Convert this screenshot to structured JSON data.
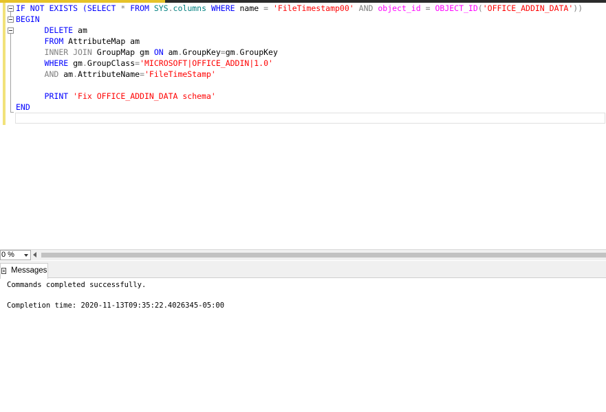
{
  "editor": {
    "lines": [
      [
        {
          "t": "IF NOT EXISTS (",
          "c": "kw"
        },
        {
          "t": "SELECT",
          "c": "kw"
        },
        {
          "t": " * ",
          "c": "gray"
        },
        {
          "t": "FROM",
          "c": "kw"
        },
        {
          "t": " ",
          "c": "plain"
        },
        {
          "t": "SYS",
          "c": "sys"
        },
        {
          "t": ".",
          "c": "gray"
        },
        {
          "t": "columns",
          "c": "sys"
        },
        {
          "t": " ",
          "c": "plain"
        },
        {
          "t": "WHERE",
          "c": "kw"
        },
        {
          "t": " name ",
          "c": "plain"
        },
        {
          "t": "=",
          "c": "gray"
        },
        {
          "t": " ",
          "c": "plain"
        },
        {
          "t": "'FileTimestamp00'",
          "c": "str"
        },
        {
          "t": " ",
          "c": "plain"
        },
        {
          "t": "AND",
          "c": "gray"
        },
        {
          "t": " object_id ",
          "c": "fn"
        },
        {
          "t": "=",
          "c": "gray"
        },
        {
          "t": " ",
          "c": "plain"
        },
        {
          "t": "OBJECT_ID",
          "c": "fn"
        },
        {
          "t": "(",
          "c": "gray"
        },
        {
          "t": "'OFFICE_ADDIN_DATA'",
          "c": "str"
        },
        {
          "t": "))",
          "c": "gray"
        }
      ],
      [
        {
          "t": "BEGIN",
          "c": "kw"
        }
      ],
      [
        {
          "t": "      ",
          "c": "plain"
        },
        {
          "t": "DELETE",
          "c": "kw"
        },
        {
          "t": " am",
          "c": "plain"
        }
      ],
      [
        {
          "t": "      ",
          "c": "plain"
        },
        {
          "t": "FROM",
          "c": "kw"
        },
        {
          "t": " AttributeMap am",
          "c": "plain"
        }
      ],
      [
        {
          "t": "      ",
          "c": "plain"
        },
        {
          "t": "INNER JOIN",
          "c": "gray"
        },
        {
          "t": " GroupMap gm ",
          "c": "plain"
        },
        {
          "t": "ON",
          "c": "kw"
        },
        {
          "t": " am",
          "c": "plain"
        },
        {
          "t": ".",
          "c": "gray"
        },
        {
          "t": "GroupKey",
          "c": "plain"
        },
        {
          "t": "=",
          "c": "gray"
        },
        {
          "t": "gm",
          "c": "plain"
        },
        {
          "t": ".",
          "c": "gray"
        },
        {
          "t": "GroupKey",
          "c": "plain"
        }
      ],
      [
        {
          "t": "      ",
          "c": "plain"
        },
        {
          "t": "WHERE",
          "c": "kw"
        },
        {
          "t": " gm",
          "c": "plain"
        },
        {
          "t": ".",
          "c": "gray"
        },
        {
          "t": "GroupClass",
          "c": "plain"
        },
        {
          "t": "=",
          "c": "gray"
        },
        {
          "t": "'MICROSOFT|OFFICE_ADDIN|1.0'",
          "c": "str"
        }
      ],
      [
        {
          "t": "      ",
          "c": "plain"
        },
        {
          "t": "AND",
          "c": "gray"
        },
        {
          "t": " am",
          "c": "plain"
        },
        {
          "t": ".",
          "c": "gray"
        },
        {
          "t": "AttributeName",
          "c": "plain"
        },
        {
          "t": "=",
          "c": "gray"
        },
        {
          "t": "'FileTimeStamp'",
          "c": "str"
        }
      ],
      [],
      [
        {
          "t": "      ",
          "c": "plain"
        },
        {
          "t": "PRINT",
          "c": "kw"
        },
        {
          "t": " ",
          "c": "plain"
        },
        {
          "t": "'Fix OFFICE_ADDIN_DATA schema'",
          "c": "str"
        }
      ],
      [
        {
          "t": "END",
          "c": "kw"
        }
      ],
      []
    ]
  },
  "zoom": {
    "value": "0 %"
  },
  "results": {
    "tab_label": "Messages",
    "line1": "Commands completed successfully.",
    "line2": "",
    "line3": "Completion time: 2020-11-13T09:35:22.4026345-05:00"
  }
}
